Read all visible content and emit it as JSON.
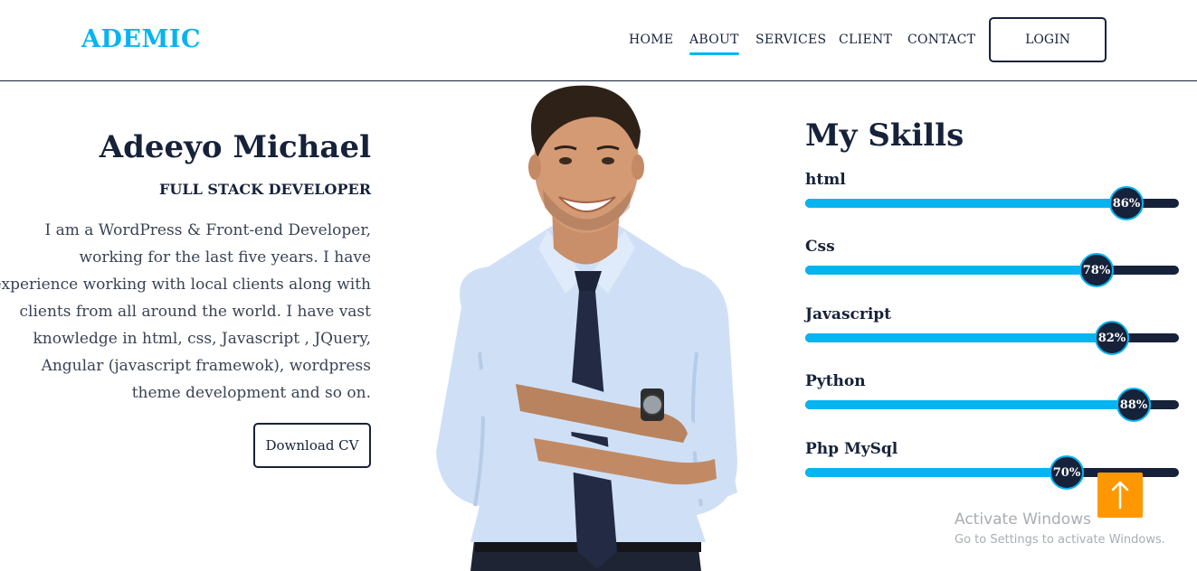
{
  "brand": {
    "logo": "ADEMIC",
    "accent": "#08b4f0",
    "dark": "#16223a"
  },
  "nav": {
    "items": [
      "HOME",
      "ABOUT",
      "SERVICES",
      "CLIENT",
      "CONTACT"
    ],
    "active": "ABOUT",
    "login": "LOGIN"
  },
  "intro": {
    "name": "Adeeyo Michael",
    "role": "FULL STACK DEVELOPER",
    "bio": "I am a WordPress & Front-end Developer, working for the last five years. I have experience working with local clients along with clients from all around the world. I have vast knowledge in html, css, Javascript , JQuery, Angular (javascript framewok), wordpress theme development and so on.",
    "cv_button": "Download CV"
  },
  "portrait": {
    "icon": "person-portrait"
  },
  "skills": {
    "title": "My Skills",
    "items": [
      {
        "label": "html",
        "percent": 86,
        "display": "86%"
      },
      {
        "label": "Css",
        "percent": 78,
        "display": "78%"
      },
      {
        "label": "Javascript",
        "percent": 82,
        "display": "82%"
      },
      {
        "label": "Python",
        "percent": 88,
        "display": "88%"
      },
      {
        "label": "Php MySql",
        "percent": 70,
        "display": "70%"
      }
    ]
  },
  "scroll_top": {
    "icon": "arrow-up-icon",
    "color": "#ff9800"
  },
  "watermark": {
    "line1": "Activate Windows",
    "line2": "Go to Settings to activate Windows."
  }
}
